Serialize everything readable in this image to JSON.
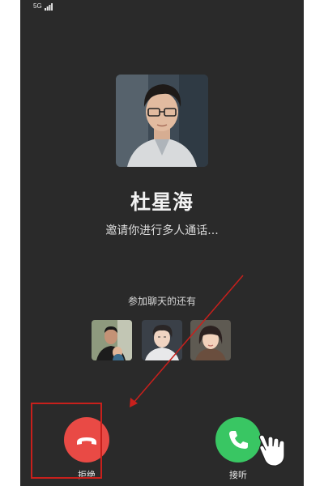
{
  "status_bar": {
    "network": "5G"
  },
  "call": {
    "caller_name": "杜星海",
    "invite_text": "邀请你进行多人通话...",
    "others_label": "参加聊天的还有",
    "participants": [
      "participant-1",
      "participant-2",
      "participant-3"
    ]
  },
  "actions": {
    "decline_label": "拒绝",
    "accept_label": "接听"
  },
  "colors": {
    "background": "#2a2a2a",
    "decline": "#e94a45",
    "accept": "#39c663",
    "annotation": "#c8201c"
  }
}
